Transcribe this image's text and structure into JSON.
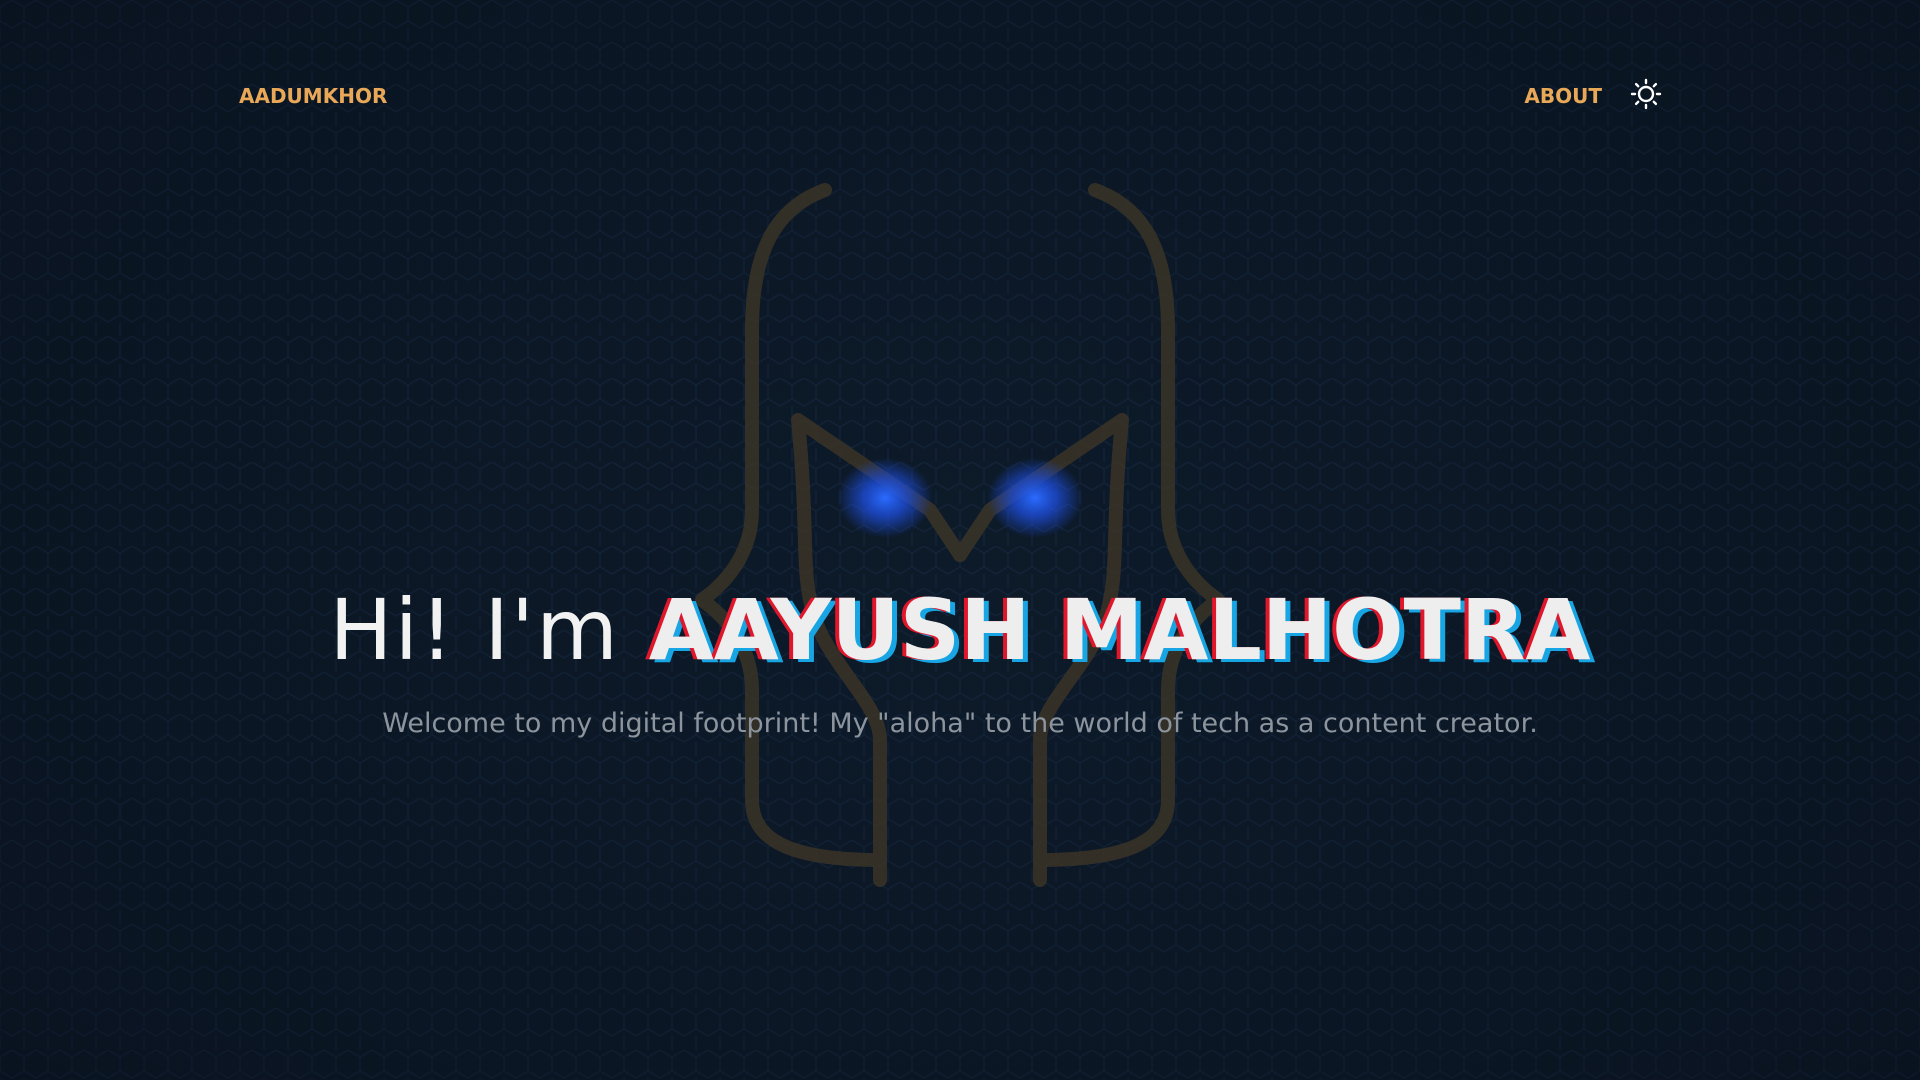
{
  "header": {
    "brand_label": "AADUMKHOR",
    "nav": {
      "about_label": "ABOUT"
    },
    "theme_toggle_icon": "sun-icon"
  },
  "hero": {
    "greeting": "Hi! I'm",
    "name": "AAYUSH MALHOTRA",
    "subtitle": "Welcome to my digital footprint! My \"aloha\" to the world of tech as a content creator."
  },
  "background": {
    "logo_icon": "aadumkhor-mask-logo",
    "pattern": "hexagon-pattern"
  },
  "colors": {
    "background": "#0d1a29",
    "accent": "#e8a857",
    "name_red": "#e0162b",
    "name_blue": "#18a5e3",
    "subtitle": "#8c949e",
    "eye_glow": "#1e5cff"
  }
}
